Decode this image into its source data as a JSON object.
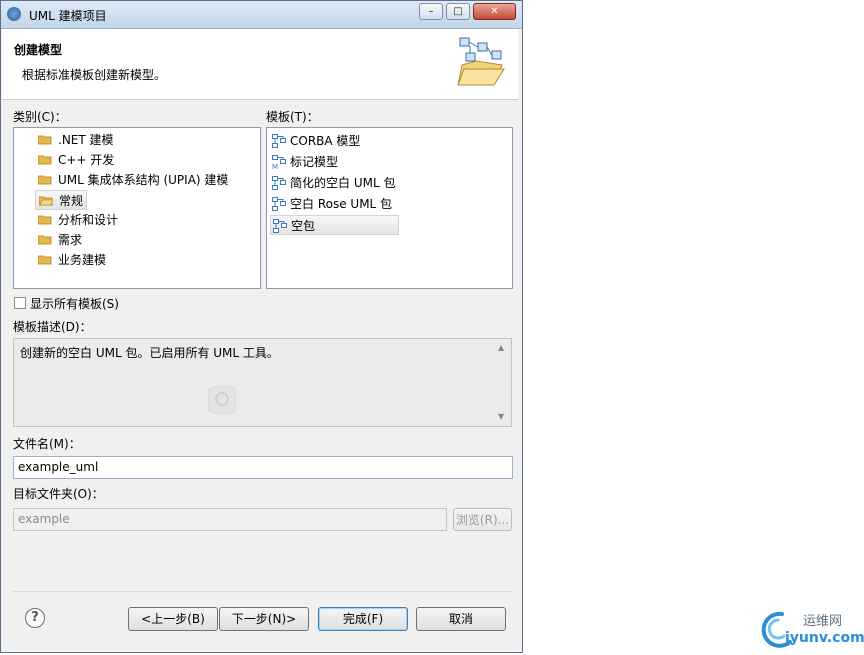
{
  "window": {
    "title": "UML 建模项目",
    "minimize": "–",
    "maximize": "□",
    "close": "✕"
  },
  "header": {
    "title": "创建模型",
    "description": "根据标准模板创建新模型。"
  },
  "categories": {
    "label": "类别(C)：",
    "items": [
      {
        "label": ".NET 建模",
        "icon": "folder-icon"
      },
      {
        "label": "C++ 开发",
        "icon": "folder-icon"
      },
      {
        "label": "UML 集成体系结构 (UPIA) 建模",
        "icon": "folder-icon"
      },
      {
        "label": "常规",
        "icon": "folder-open-icon",
        "selected": true
      },
      {
        "label": "分析和设计",
        "icon": "folder-icon"
      },
      {
        "label": "需求",
        "icon": "folder-icon"
      },
      {
        "label": "业务建模",
        "icon": "folder-icon"
      }
    ]
  },
  "templates": {
    "label": "模板(T)：",
    "items": [
      {
        "label": "CORBA 模型",
        "icon": "uml-package-icon"
      },
      {
        "label": "标记模型",
        "icon": "uml-model-icon"
      },
      {
        "label": "简化的空白 UML 包",
        "icon": "uml-package-icon"
      },
      {
        "label": "空白 Rose UML 包",
        "icon": "uml-package-icon"
      },
      {
        "label": "空包",
        "icon": "uml-package-icon",
        "selected": true
      }
    ]
  },
  "show_all": {
    "label": "显示所有模板(S)",
    "checked": false
  },
  "template_description": {
    "label": "模板描述(D)：",
    "text": "创建新的空白 UML 包。已启用所有 UML 工具。"
  },
  "file_name": {
    "label": "文件名(M)：",
    "value": "example_uml"
  },
  "target_folder": {
    "label": "目标文件夹(O)：",
    "value": "example",
    "browse_label": "浏览(R)..."
  },
  "footer": {
    "help": "?",
    "back_label": "<上一步(B)",
    "next_label": "下一步(N)>",
    "finish_label": "完成(F)",
    "cancel_label": "取消"
  },
  "watermark": {
    "line1": "运维网",
    "line2": "iyunv.com"
  },
  "colors": {
    "titlebar": "#c4d5ea",
    "dialog_bg": "#f0f0f0",
    "folder": "#e8b84a",
    "uml_icon": "#3a7bbf"
  }
}
